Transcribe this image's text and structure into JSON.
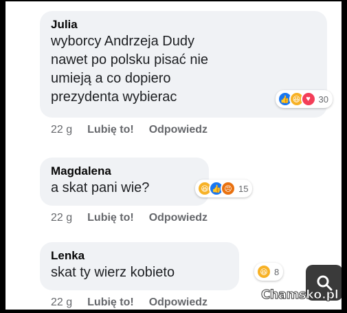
{
  "comments": [
    {
      "author": "Julia",
      "text": "wyborcy Andrzeja Dudy\nnawet po polsku pisać nie\numieją a co dopiero\nprezydenta wybierac",
      "time": "22 g",
      "like_label": "Lubię to!",
      "reply_label": "Odpowiedz",
      "reactions": [
        "like",
        "haha",
        "love"
      ],
      "reaction_count": "30"
    },
    {
      "author": "Magdalena",
      "text": "a skat pani wie?",
      "time": "22 g",
      "like_label": "Lubię to!",
      "reply_label": "Odpowiedz",
      "reactions": [
        "haha",
        "like",
        "angry"
      ],
      "reaction_count": "15"
    },
    {
      "author": "Lenka",
      "text": "skat ty wierz kobieto",
      "time": "22 g",
      "like_label": "Lubię to!",
      "reply_label": "Odpowiedz",
      "reactions": [
        "haha"
      ],
      "reaction_count": "8"
    }
  ],
  "watermark": {
    "text": "Chamsko.pl",
    "icon": "search-icon"
  },
  "colors": {
    "bubble": "#f0f2f5",
    "meta_text": "#65676b",
    "like": "#1877f2",
    "haha": "#f7b125",
    "love": "#f33e58",
    "angry": "#e9710f"
  }
}
